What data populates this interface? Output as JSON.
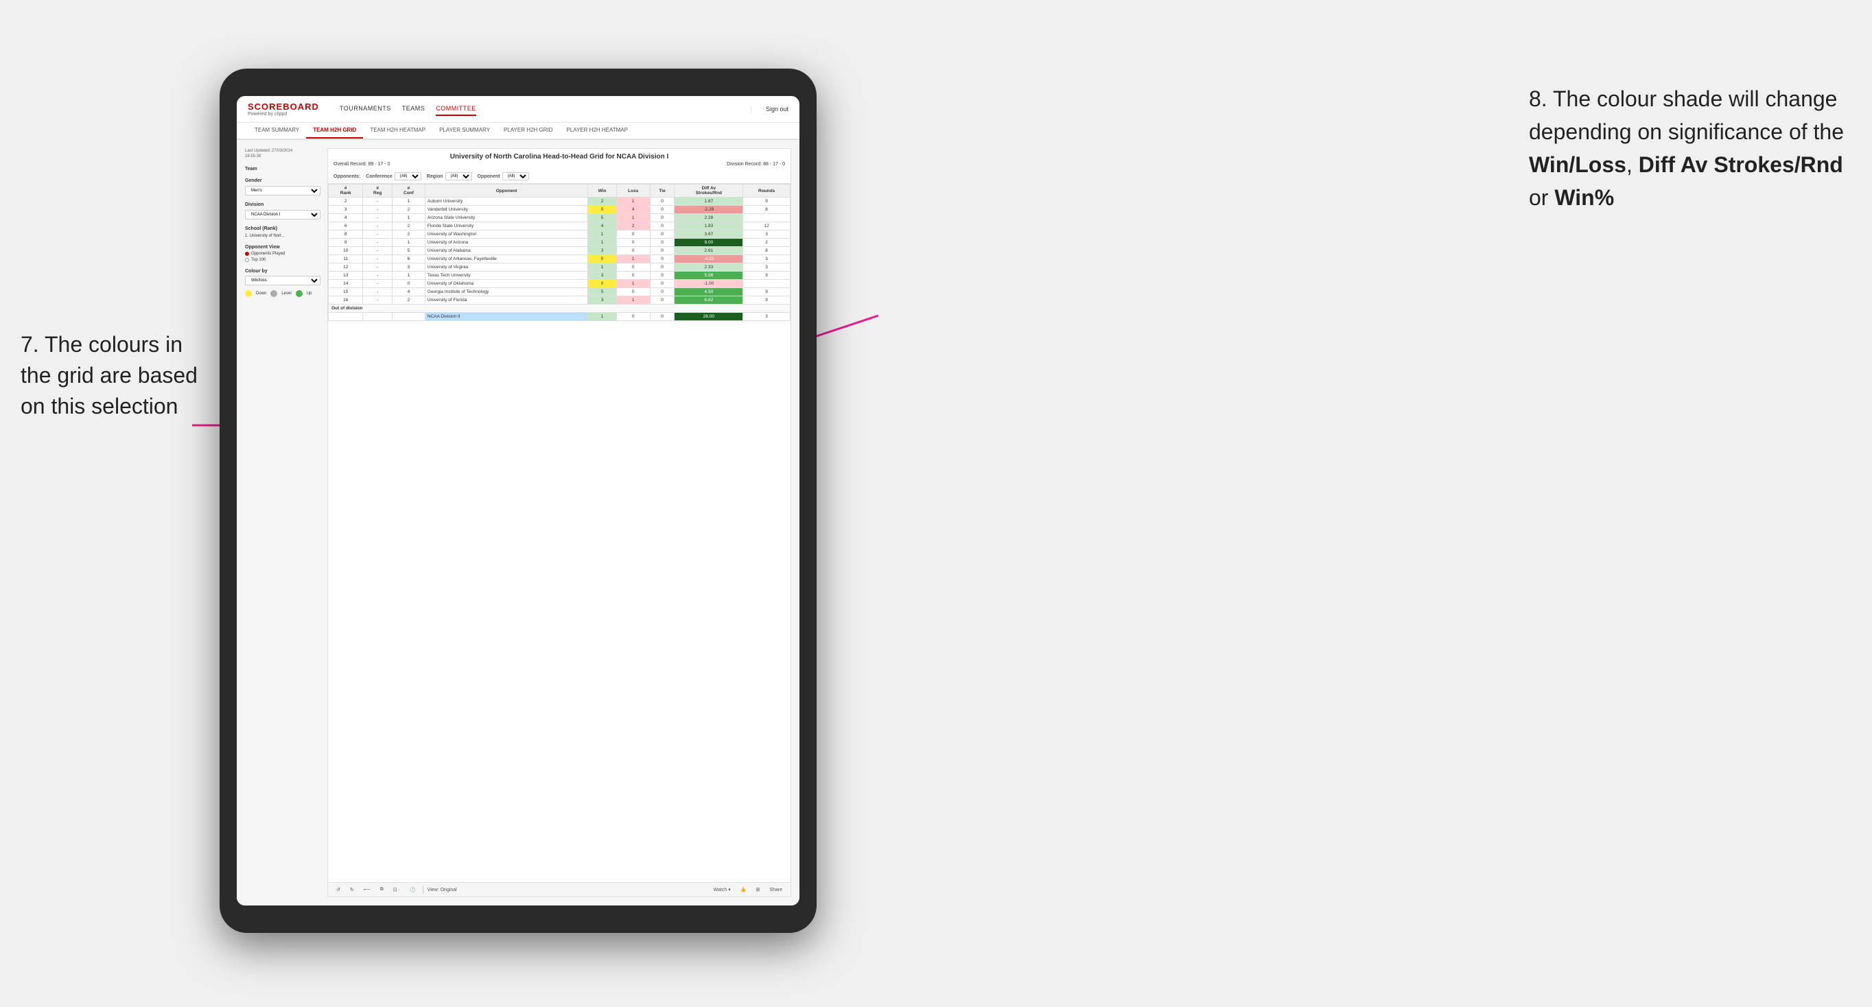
{
  "annotations": {
    "left": {
      "line1": "7. The colours in",
      "line2": "the grid are based",
      "line3": "on this selection"
    },
    "right": {
      "intro": "8. The colour shade will change depending on significance of the ",
      "bold1": "Win/Loss",
      "sep1": ", ",
      "bold2": "Diff Av Strokes/Rnd",
      "sep2": " or ",
      "bold3": "Win%"
    }
  },
  "app": {
    "logo": "SCOREBOARD",
    "logo_sub": "Powered by clippd",
    "nav": {
      "items": [
        "TOURNAMENTS",
        "TEAMS",
        "COMMITTEE"
      ],
      "active": "COMMITTEE"
    },
    "sign_out": "Sign out",
    "sub_nav": {
      "items": [
        "TEAM SUMMARY",
        "TEAM H2H GRID",
        "TEAM H2H HEATMAP",
        "PLAYER SUMMARY",
        "PLAYER H2H GRID",
        "PLAYER H2H HEATMAP"
      ],
      "active": "TEAM H2H GRID"
    }
  },
  "sidebar": {
    "timestamp_label": "Last Updated: 27/03/2024",
    "timestamp_time": "16:55:38",
    "team_label": "Team",
    "gender_label": "Gender",
    "gender_value": "Men's",
    "division_label": "Division",
    "division_value": "NCAA Division I",
    "school_label": "School (Rank)",
    "school_value": "1. University of Nort...",
    "opponent_view_label": "Opponent View",
    "radio_options": [
      "Opponents Played",
      "Top 100"
    ],
    "radio_selected": 0,
    "colour_by_label": "Colour by",
    "colour_by_value": "Win/loss",
    "legend": [
      {
        "color": "#ffeb3b",
        "label": "Down"
      },
      {
        "color": "#aaaaaa",
        "label": "Level"
      },
      {
        "color": "#4caf50",
        "label": "Up"
      }
    ]
  },
  "grid": {
    "title": "University of North Carolina Head-to-Head Grid for NCAA Division I",
    "overall_record": "Overall Record: 89 - 17 - 0",
    "division_record": "Division Record: 88 - 17 - 0",
    "filters": {
      "conference_label": "Conference",
      "conference_value": "(All)",
      "region_label": "Region",
      "region_value": "(All)",
      "opponent_label": "Opponent",
      "opponent_value": "(All)",
      "opponents_label": "Opponents:"
    },
    "table_headers": [
      "#\nRank",
      "#\nReg",
      "#\nConf",
      "Opponent",
      "Win",
      "Loss",
      "Tie",
      "Diff Av\nStrokes/Rnd",
      "Rounds"
    ],
    "rows": [
      {
        "rank": "2",
        "reg": "-",
        "conf": "1",
        "opponent": "Auburn University",
        "win": "2",
        "loss": "1",
        "tie": "0",
        "diff": "1.67",
        "rounds": "9",
        "win_color": "green-light",
        "loss_color": "red-light",
        "diff_color": "green-light"
      },
      {
        "rank": "3",
        "reg": "-",
        "conf": "2",
        "opponent": "Vanderbilt University",
        "win": "0",
        "loss": "4",
        "tie": "0",
        "diff": "-2.29",
        "rounds": "8",
        "win_color": "yellow",
        "loss_color": "red",
        "diff_color": "red-light"
      },
      {
        "rank": "4",
        "reg": "-",
        "conf": "1",
        "opponent": "Arizona State University",
        "win": "5",
        "loss": "1",
        "tie": "0",
        "diff": "2.28",
        "rounds": "",
        "win_color": "green",
        "loss_color": "red-light",
        "diff_color": "green-light"
      },
      {
        "rank": "6",
        "reg": "-",
        "conf": "2",
        "opponent": "Florida State University",
        "win": "4",
        "loss": "2",
        "tie": "0",
        "diff": "1.83",
        "rounds": "12",
        "win_color": "green-light",
        "loss_color": "yellow",
        "diff_color": "green-light"
      },
      {
        "rank": "8",
        "reg": "-",
        "conf": "2",
        "opponent": "University of Washington",
        "win": "1",
        "loss": "0",
        "tie": "0",
        "diff": "3.67",
        "rounds": "3",
        "win_color": "green-light",
        "loss_color": "white",
        "diff_color": "green"
      },
      {
        "rank": "9",
        "reg": "-",
        "conf": "1",
        "opponent": "University of Arizona",
        "win": "1",
        "loss": "0",
        "tie": "0",
        "diff": "9.00",
        "rounds": "2",
        "win_color": "green-light",
        "loss_color": "white",
        "diff_color": "green-dark"
      },
      {
        "rank": "10",
        "reg": "-",
        "conf": "5",
        "opponent": "University of Alabama",
        "win": "3",
        "loss": "0",
        "tie": "0",
        "diff": "2.61",
        "rounds": "8",
        "win_color": "green",
        "loss_color": "white",
        "diff_color": "green-light"
      },
      {
        "rank": "11",
        "reg": "-",
        "conf": "6",
        "opponent": "University of Arkansas, Fayetteville",
        "win": "0",
        "loss": "1",
        "tie": "0",
        "diff": "-4.33",
        "rounds": "3",
        "win_color": "yellow",
        "loss_color": "red-light",
        "diff_color": "red"
      },
      {
        "rank": "12",
        "reg": "-",
        "conf": "3",
        "opponent": "University of Virginia",
        "win": "1",
        "loss": "0",
        "tie": "0",
        "diff": "2.33",
        "rounds": "3",
        "win_color": "green-light",
        "loss_color": "white",
        "diff_color": "green-light"
      },
      {
        "rank": "13",
        "reg": "-",
        "conf": "1",
        "opponent": "Texas Tech University",
        "win": "3",
        "loss": "0",
        "tie": "0",
        "diff": "5.56",
        "rounds": "9",
        "win_color": "green",
        "loss_color": "white",
        "diff_color": "green"
      },
      {
        "rank": "14",
        "reg": "-",
        "conf": "0",
        "opponent": "University of Oklahoma",
        "win": "0",
        "loss": "1",
        "tie": "0",
        "diff": "-1.00",
        "rounds": "",
        "win_color": "yellow",
        "loss_color": "red-light",
        "diff_color": "red-light"
      },
      {
        "rank": "15",
        "reg": "-",
        "conf": "4",
        "opponent": "Georgia Institute of Technology",
        "win": "5",
        "loss": "0",
        "tie": "0",
        "diff": "4.50",
        "rounds": "9",
        "win_color": "green",
        "loss_color": "white",
        "diff_color": "green"
      },
      {
        "rank": "16",
        "reg": "-",
        "conf": "2",
        "opponent": "University of Florida",
        "win": "3",
        "loss": "1",
        "tie": "0",
        "diff": "6.62",
        "rounds": "9",
        "win_color": "green",
        "loss_color": "red-light",
        "diff_color": "green"
      }
    ],
    "out_of_division_label": "Out of division",
    "out_of_division_row": {
      "division": "NCAA Division II",
      "win": "1",
      "loss": "0",
      "tie": "0",
      "diff": "26.00",
      "rounds": "3"
    }
  },
  "toolbar": {
    "view_label": "View: Original",
    "watch_label": "Watch ▾",
    "share_label": "Share"
  }
}
